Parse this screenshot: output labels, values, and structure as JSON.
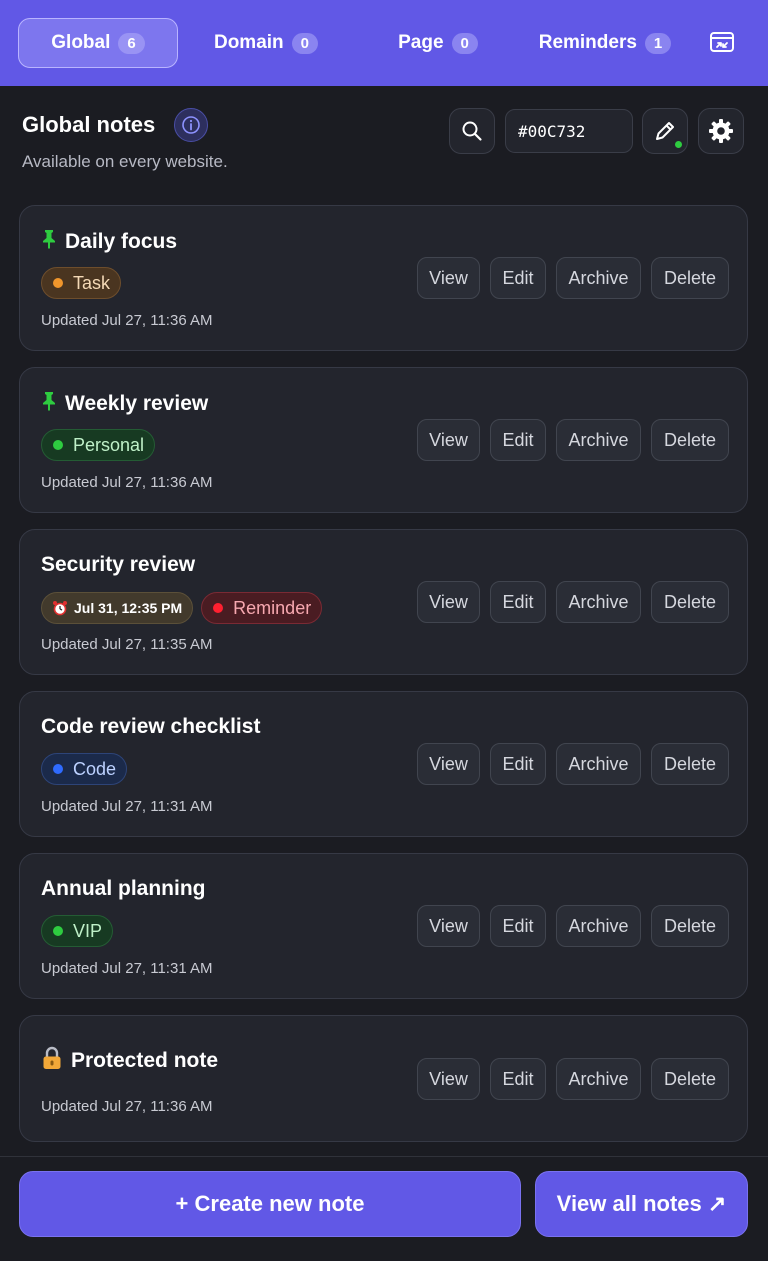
{
  "tabs": [
    {
      "label": "Global",
      "count": "6"
    },
    {
      "label": "Domain",
      "count": "0"
    },
    {
      "label": "Page",
      "count": "0"
    },
    {
      "label": "Reminders",
      "count": "1"
    }
  ],
  "header": {
    "title": "Global notes",
    "subtitle": "Available on every website.",
    "color_value": "#00C732"
  },
  "notes": [
    {
      "title": "Daily focus",
      "pinned": true,
      "tags": [
        "Task"
      ],
      "updated": "Updated Jul 27, 11:36 AM"
    },
    {
      "title": "Weekly review",
      "pinned": true,
      "tags": [
        "Personal"
      ],
      "updated": "Updated Jul 27, 11:36 AM"
    },
    {
      "title": "Security review",
      "pinned": false,
      "reminder_date": "Jul 31, 12:35 PM",
      "tags": [
        "Reminder"
      ],
      "updated": "Updated Jul 27, 11:35 AM"
    },
    {
      "title": "Code review checklist",
      "pinned": false,
      "tags": [
        "Code"
      ],
      "updated": "Updated Jul 27, 11:31 AM"
    },
    {
      "title": "Annual planning",
      "pinned": false,
      "tags": [
        "VIP"
      ],
      "updated": "Updated Jul 27, 11:31 AM"
    },
    {
      "title": "Protected note",
      "locked": true,
      "tags": [],
      "updated": "Updated Jul 27, 11:36 AM"
    }
  ],
  "actions": {
    "view": "View",
    "edit": "Edit",
    "archive": "Archive",
    "delete": "Delete"
  },
  "footer": {
    "create_label": "+  Create new note",
    "view_all_label": "View all notes ↗"
  },
  "colors": {
    "accent": "#6158e6",
    "background": "#1b1c22",
    "card": "#23252d"
  }
}
